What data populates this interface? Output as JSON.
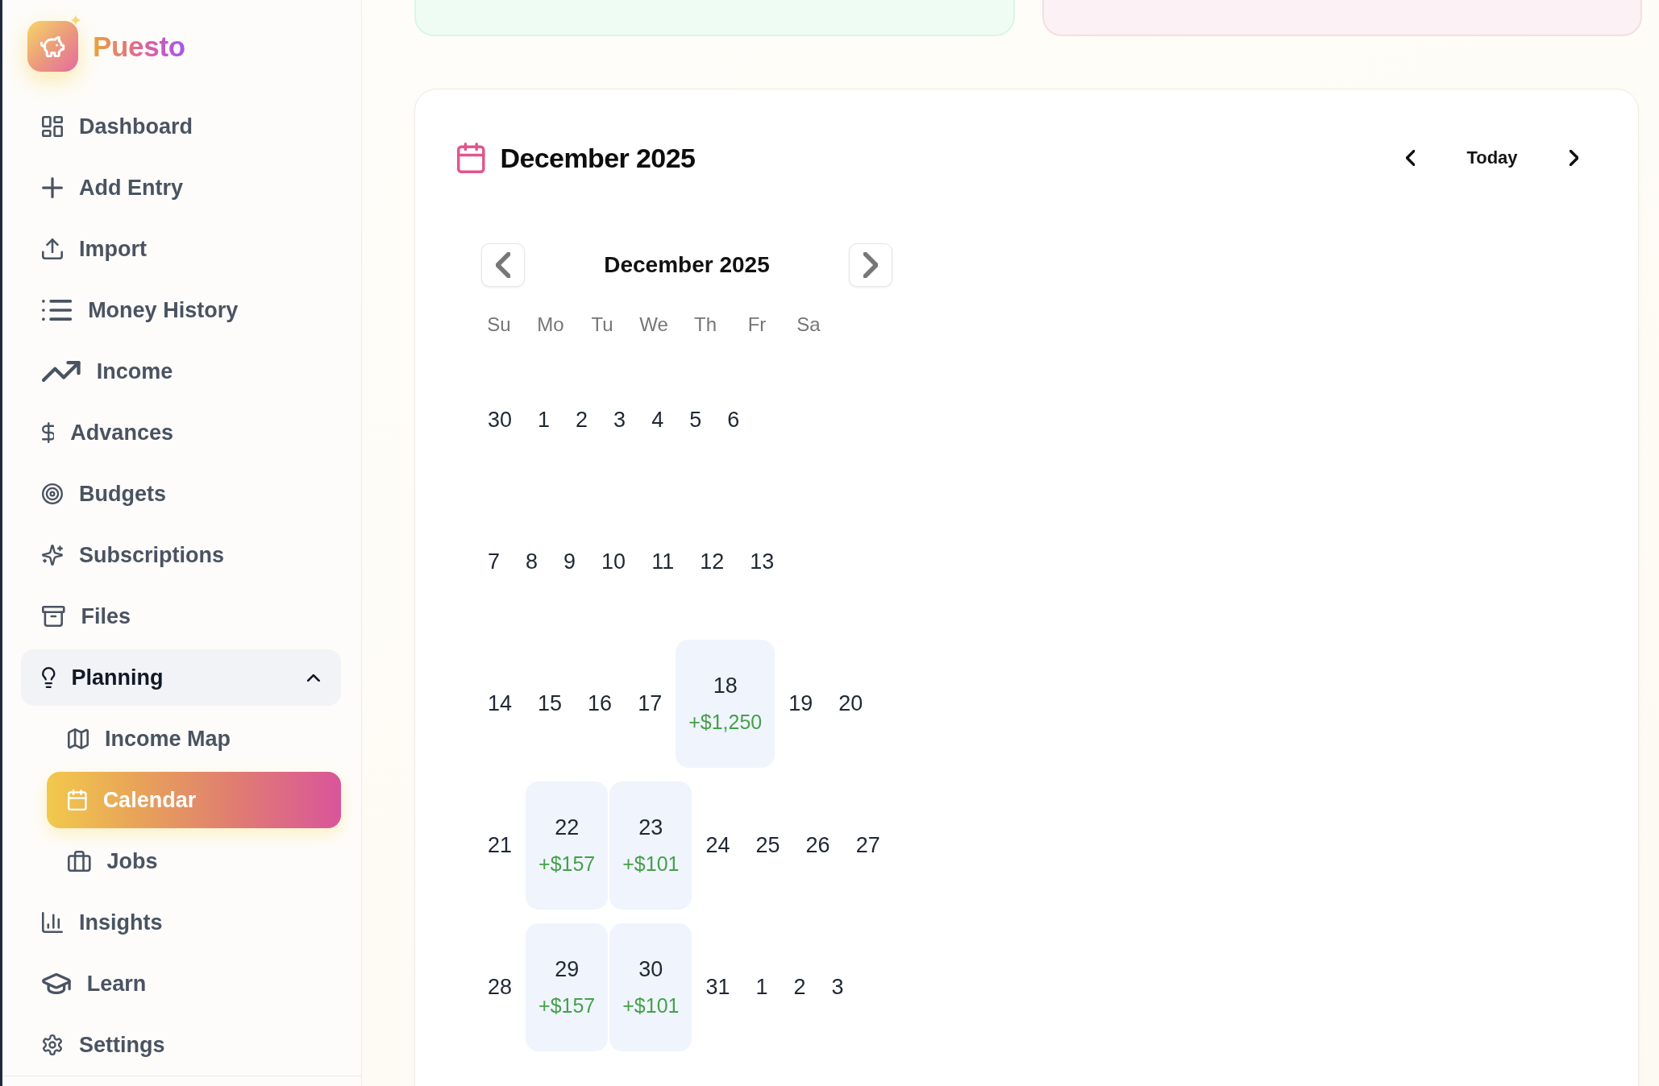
{
  "brand": {
    "name": "Puesto"
  },
  "sidebar": {
    "items": [
      {
        "label": "Dashboard",
        "selected": false
      },
      {
        "label": "Add Entry",
        "selected": false
      },
      {
        "label": "Import",
        "selected": false
      },
      {
        "label": "Money History",
        "selected": false
      },
      {
        "label": "Income",
        "selected": false
      },
      {
        "label": "Advances",
        "selected": false
      },
      {
        "label": "Budgets",
        "selected": false
      },
      {
        "label": "Subscriptions",
        "selected": false
      },
      {
        "label": "Files",
        "selected": false
      },
      {
        "label": "Planning",
        "selected": false,
        "expanded": true,
        "children": [
          {
            "label": "Income Map",
            "selected": false
          },
          {
            "label": "Calendar",
            "selected": true
          },
          {
            "label": "Jobs",
            "selected": false
          }
        ]
      },
      {
        "label": "Insights",
        "selected": false
      },
      {
        "label": "Learn",
        "selected": false
      },
      {
        "label": "Settings",
        "selected": false
      }
    ]
  },
  "calendar_card": {
    "title": "December 2025",
    "today_button": "Today",
    "date_picker": {
      "title": "December 2025",
      "weekdays": [
        "Su",
        "Mo",
        "Tu",
        "We",
        "Th",
        "Fr",
        "Sa"
      ],
      "weeks": [
        [
          {
            "day": "30",
            "kind": "plain"
          },
          {
            "day": "1",
            "kind": "plain"
          },
          {
            "day": "2",
            "kind": "plain"
          },
          {
            "day": "3",
            "kind": "plain"
          },
          {
            "day": "4",
            "kind": "plain"
          },
          {
            "day": "5",
            "kind": "plain"
          },
          {
            "day": "6",
            "kind": "plain"
          }
        ],
        [
          {
            "day": "7",
            "kind": "plain"
          },
          {
            "day": "8",
            "kind": "plain"
          },
          {
            "day": "9",
            "kind": "plain"
          },
          {
            "day": "10",
            "kind": "plain"
          },
          {
            "day": "11",
            "kind": "plain"
          },
          {
            "day": "12",
            "kind": "plain"
          },
          {
            "day": "13",
            "kind": "plain"
          }
        ],
        [
          {
            "day": "14",
            "kind": "plain"
          },
          {
            "day": "15",
            "kind": "plain"
          },
          {
            "day": "16",
            "kind": "plain"
          },
          {
            "day": "17",
            "kind": "plain"
          },
          {
            "day": "18",
            "kind": "income",
            "amount": "+$1,250"
          },
          {
            "day": "19",
            "kind": "plain"
          },
          {
            "day": "20",
            "kind": "plain"
          }
        ],
        [
          {
            "day": "21",
            "kind": "plain"
          },
          {
            "day": "22",
            "kind": "income",
            "amount": "+$157"
          },
          {
            "day": "23",
            "kind": "income",
            "amount": "+$101"
          },
          {
            "day": "24",
            "kind": "plain"
          },
          {
            "day": "25",
            "kind": "plain"
          },
          {
            "day": "26",
            "kind": "plain"
          },
          {
            "day": "27",
            "kind": "plain"
          }
        ],
        [
          {
            "day": "28",
            "kind": "plain"
          },
          {
            "day": "29",
            "kind": "income",
            "amount": "+$157"
          },
          {
            "day": "30",
            "kind": "income",
            "amount": "+$101"
          },
          {
            "day": "31",
            "kind": "plain"
          },
          {
            "day": "1",
            "kind": "plain"
          },
          {
            "day": "2",
            "kind": "plain"
          },
          {
            "day": "3",
            "kind": "plain"
          }
        ]
      ]
    }
  }
}
